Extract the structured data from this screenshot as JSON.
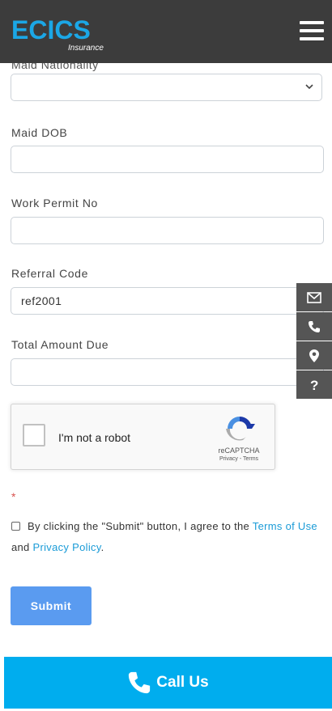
{
  "header": {
    "logo_main": "ECICS",
    "logo_sub": "Insurance"
  },
  "form": {
    "clipped_label": "Maid Nationality",
    "nationality_value": "",
    "dob_label": "Maid DOB",
    "dob_value": "",
    "permit_label": "Work Permit No",
    "permit_value": "",
    "referral_label": "Referral Code",
    "referral_value": "ref2001",
    "amount_label": "Total Amount Due",
    "amount_value": "",
    "asterisk": "*"
  },
  "side_tools": [
    "envelope-icon",
    "phone-icon",
    "location-pin-icon",
    "question-icon"
  ],
  "recaptcha": {
    "label": "I'm not a robot",
    "brand": "reCAPTCHA",
    "links": "Privacy - Terms"
  },
  "agreement": {
    "text_before": "By clicking the \"Submit\" button, I agree to the ",
    "terms_link": "Terms of Use",
    "and": " and ",
    "privacy_link": "Privacy Policy",
    "end": "."
  },
  "submit_label": "Submit",
  "call_bar": {
    "label": "Call Us"
  },
  "colors": {
    "header_bg": "#3c3c3c",
    "logo_blue": "#1ba7e6",
    "link": "#1a9bd7",
    "submit_bg": "#5a9bf0",
    "call_bar_bg": "#00adee",
    "side_tool_bg": "#555555"
  }
}
